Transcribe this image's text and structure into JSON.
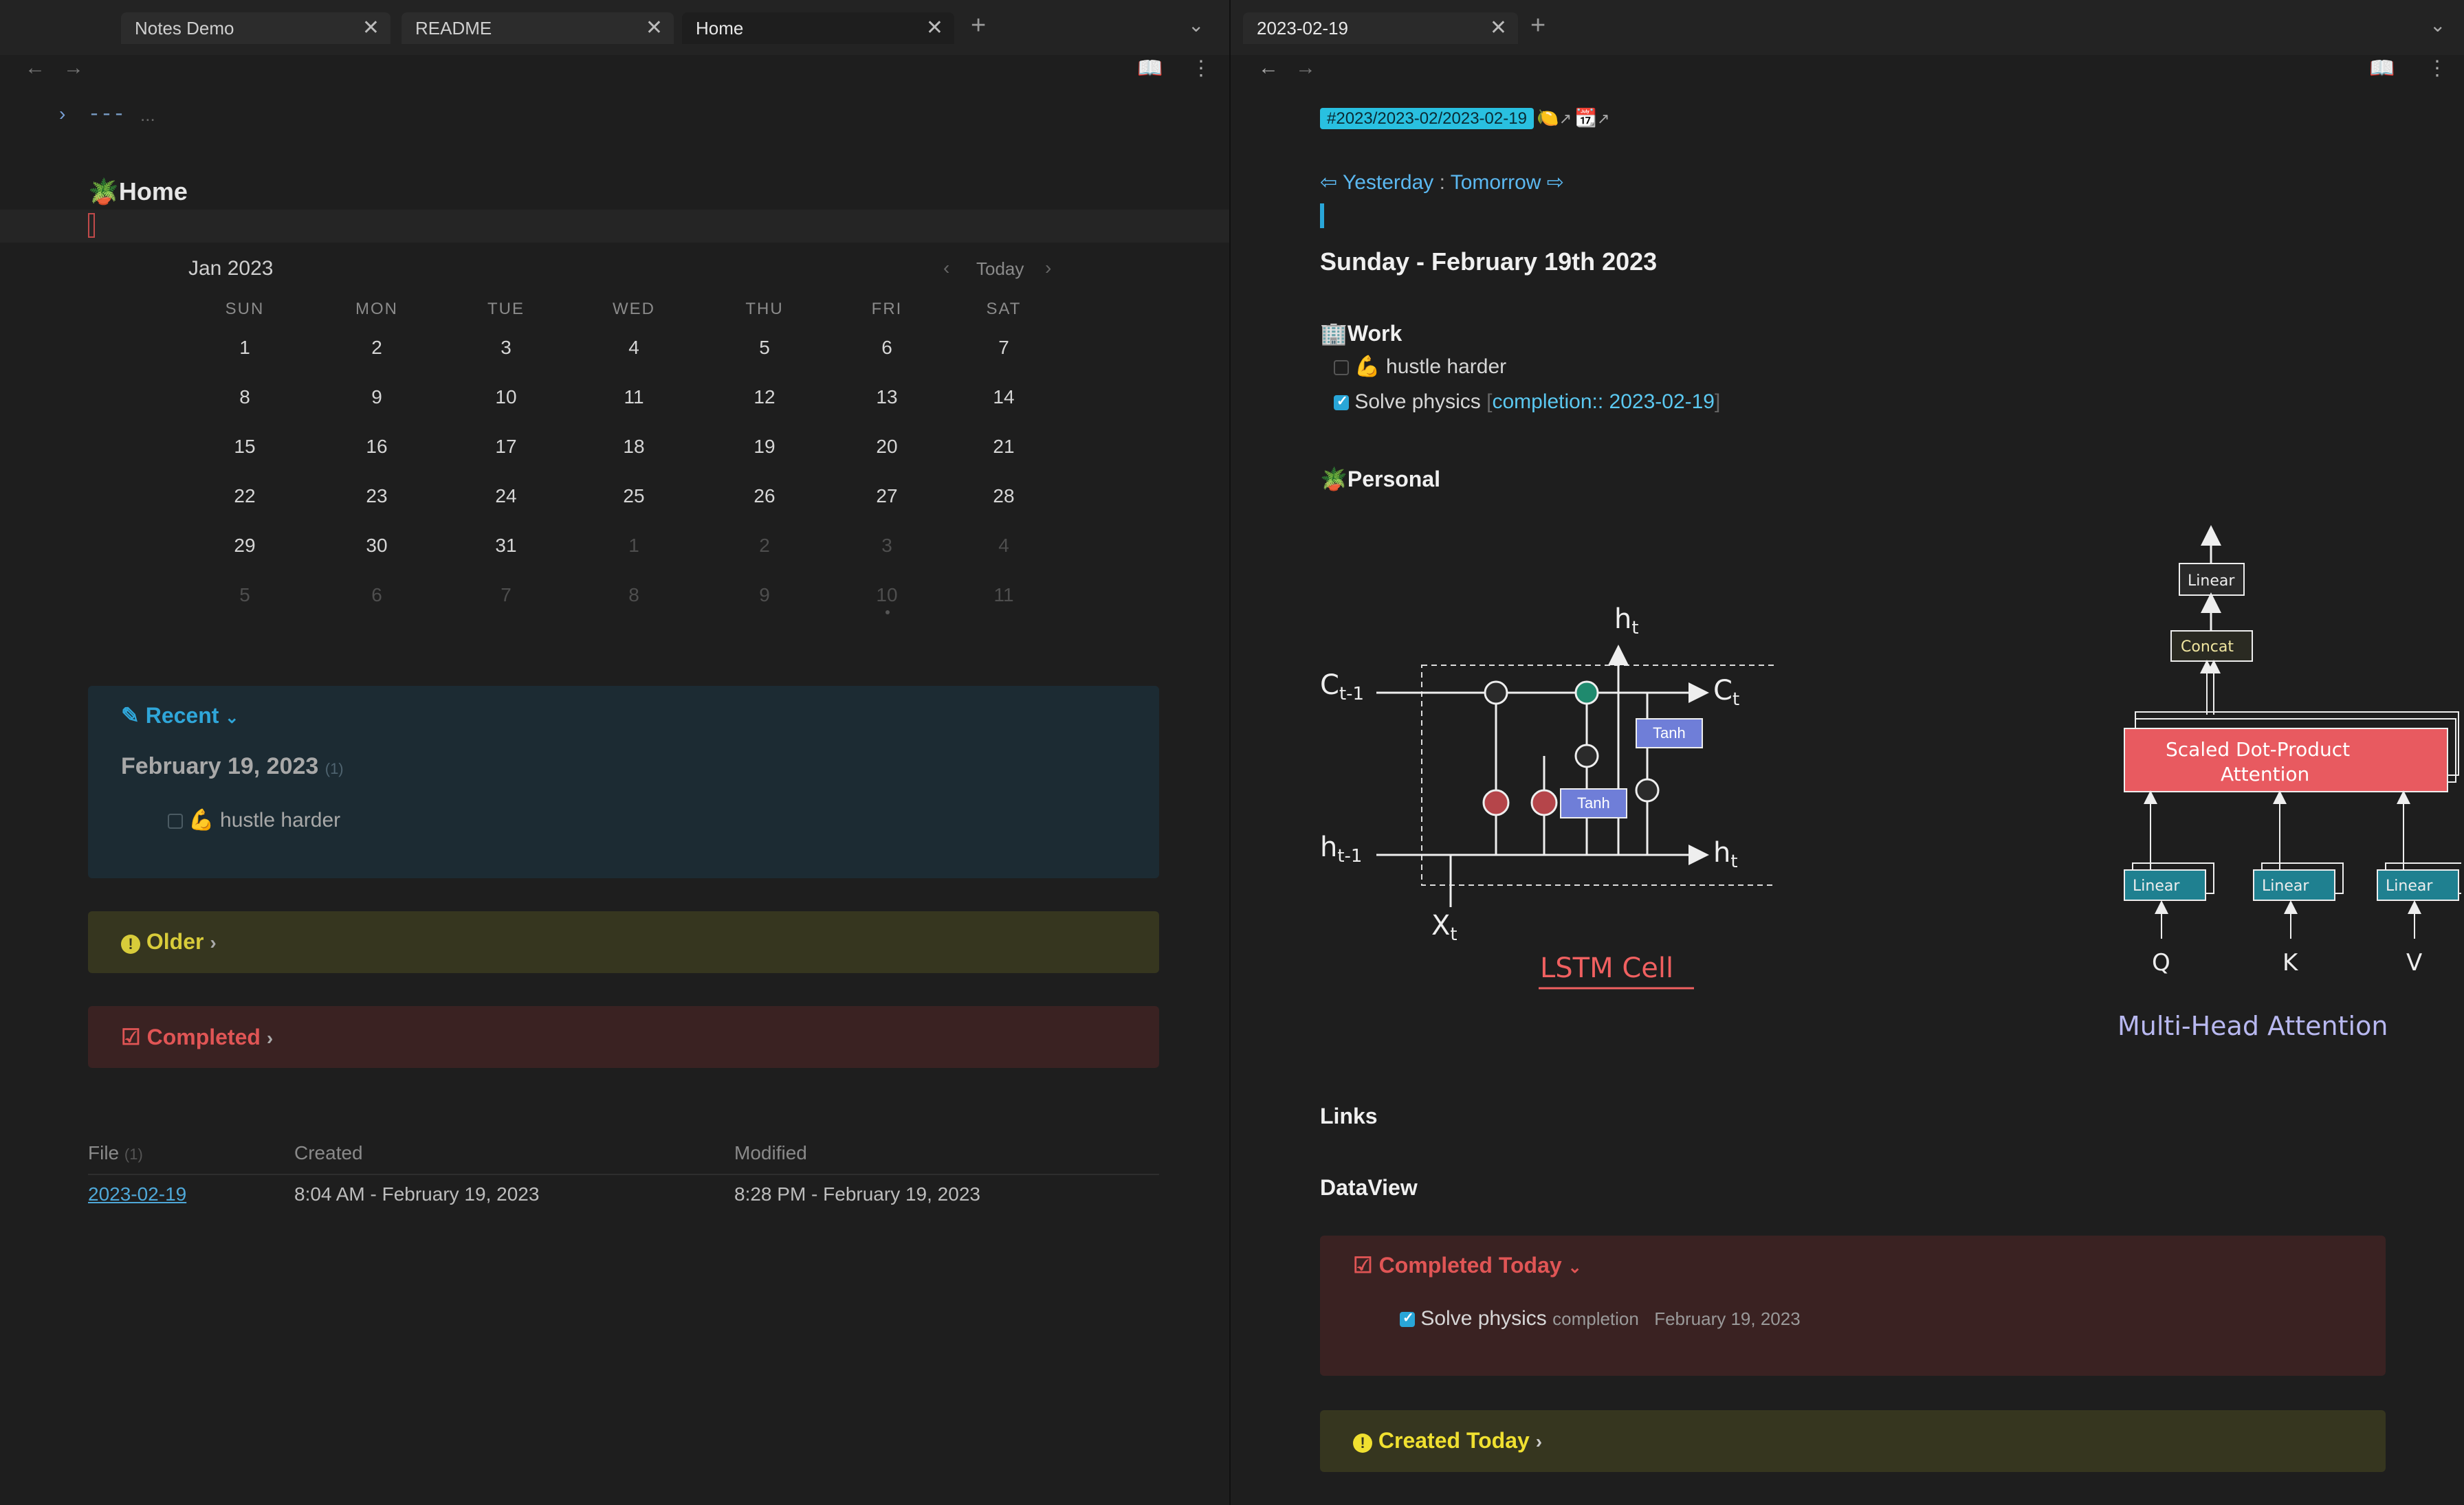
{
  "left": {
    "tabs": [
      {
        "label": "Notes Demo"
      },
      {
        "label": "README"
      },
      {
        "label": "Home"
      }
    ],
    "frontmatter": "---",
    "frontmatter_dots": "...",
    "page_title": "Home",
    "calendar": {
      "month": "Jan 2023",
      "today_label": "Today",
      "weekdays": [
        "SUN",
        "MON",
        "TUE",
        "WED",
        "THU",
        "FRI",
        "SAT"
      ],
      "weeks": [
        [
          "1",
          "2",
          "3",
          "4",
          "5",
          "6",
          "7"
        ],
        [
          "8",
          "9",
          "10",
          "11",
          "12",
          "13",
          "14"
        ],
        [
          "15",
          "16",
          "17",
          "18",
          "19",
          "20",
          "21"
        ],
        [
          "22",
          "23",
          "24",
          "25",
          "26",
          "27",
          "28"
        ],
        [
          "29",
          "30",
          "31",
          "1",
          "2",
          "3",
          "4"
        ],
        [
          "5",
          "6",
          "7",
          "8",
          "9",
          "10",
          "11"
        ]
      ]
    },
    "recent": {
      "title": "Recent",
      "date": "February 19, 2023",
      "count": "(1)",
      "task_emoji": "💪",
      "task": "hustle harder"
    },
    "older": {
      "title": "Older"
    },
    "completed": {
      "title": "Completed"
    },
    "table": {
      "headers": [
        "File",
        "Created",
        "Modified"
      ],
      "file_count": "(1)",
      "rows": [
        {
          "file": "2023-02-19",
          "created": "8:04 AM - February 19, 2023",
          "modified": "8:28 PM - February 19, 2023"
        }
      ]
    }
  },
  "right": {
    "tab": {
      "label": "2023-02-19"
    },
    "tag": "#2023/2023-02/2023-02-19",
    "nav": {
      "yesterday": "Yesterday",
      "sep": ":",
      "tomorrow": "Tomorrow"
    },
    "heading": "Sunday - February 19th 2023",
    "work": {
      "title": "Work",
      "tasks": [
        {
          "emoji": "💪",
          "label": "hustle harder"
        },
        {
          "label": "Solve physics",
          "field": "completion:: 2023-02-19"
        }
      ]
    },
    "personal": {
      "title": "Personal"
    },
    "lstm": {
      "caption": "LSTM Cell",
      "labels": {
        "c_in": "C",
        "c_in_sub": "t-1",
        "c_out": "C",
        "c_out_sub": "t",
        "h_in": "h",
        "h_in_sub": "t-1",
        "h_out": "h",
        "h_out_sub": "t",
        "h_top": "h",
        "h_top_sub": "t",
        "x": "X",
        "x_sub": "t",
        "tanh1": "Tanh",
        "tanh2": "Tanh"
      }
    },
    "mha": {
      "caption": "Multi-Head Attention",
      "labels": {
        "linear_top": "Linear",
        "concat": "Concat",
        "sdpa1": "Scaled Dot-Product",
        "sdpa2": "Attention",
        "lin_q": "Linear",
        "lin_k": "Linear",
        "lin_v": "Linear",
        "q": "Q",
        "k": "K",
        "v": "V"
      }
    },
    "links_title": "Links",
    "dataview_title": "DataView",
    "completed_today": {
      "title": "Completed Today",
      "task": "Solve physics",
      "field": "completion",
      "date": "February 19, 2023"
    },
    "created_today": {
      "title": "Created Today"
    }
  },
  "colors": {
    "bg": "#1e1e1e",
    "accent": "#29a6d8",
    "recent_bg": "#1c2b33",
    "older_bg": "#36361f",
    "completed_bg": "#3a2222",
    "tag_bg": "#29c0e0",
    "completed_red": "#e05555",
    "yellow": "#e6d84a"
  }
}
